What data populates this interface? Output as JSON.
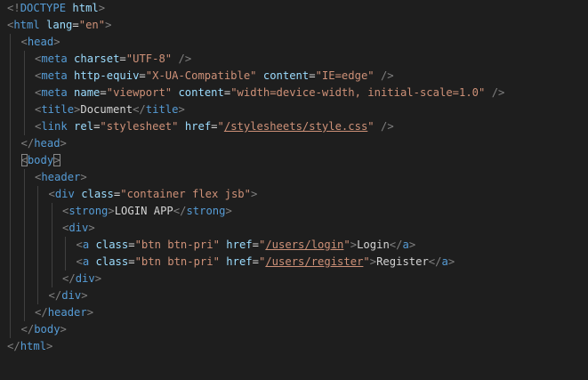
{
  "editor": {
    "language": "html",
    "theme_colors": {
      "background": "#1e1e1e",
      "punctuation": "#808080",
      "tag": "#569cd6",
      "attribute": "#9cdcfe",
      "string": "#ce9178",
      "text": "#d4d4d4",
      "indent_guide": "#404040"
    },
    "lines": [
      {
        "indent": 0,
        "tokens": [
          {
            "t": "punct",
            "v": "<!"
          },
          {
            "t": "tag",
            "v": "DOCTYPE"
          },
          {
            "t": "text",
            "v": " "
          },
          {
            "t": "attr",
            "v": "html"
          },
          {
            "t": "punct",
            "v": ">"
          }
        ]
      },
      {
        "indent": 0,
        "tokens": [
          {
            "t": "punct",
            "v": "<"
          },
          {
            "t": "tag",
            "v": "html"
          },
          {
            "t": "text",
            "v": " "
          },
          {
            "t": "attr",
            "v": "lang"
          },
          {
            "t": "text",
            "v": "="
          },
          {
            "t": "str",
            "v": "\"en\""
          },
          {
            "t": "punct",
            "v": ">"
          }
        ]
      },
      {
        "indent": 1,
        "tokens": [
          {
            "t": "punct",
            "v": "<"
          },
          {
            "t": "tag",
            "v": "head"
          },
          {
            "t": "punct",
            "v": ">"
          }
        ]
      },
      {
        "indent": 2,
        "tokens": [
          {
            "t": "punct",
            "v": "<"
          },
          {
            "t": "tag",
            "v": "meta"
          },
          {
            "t": "text",
            "v": " "
          },
          {
            "t": "attr",
            "v": "charset"
          },
          {
            "t": "text",
            "v": "="
          },
          {
            "t": "str",
            "v": "\"UTF-8\""
          },
          {
            "t": "text",
            "v": " "
          },
          {
            "t": "punct",
            "v": "/>"
          }
        ]
      },
      {
        "indent": 2,
        "tokens": [
          {
            "t": "punct",
            "v": "<"
          },
          {
            "t": "tag",
            "v": "meta"
          },
          {
            "t": "text",
            "v": " "
          },
          {
            "t": "attr",
            "v": "http-equiv"
          },
          {
            "t": "text",
            "v": "="
          },
          {
            "t": "str",
            "v": "\"X-UA-Compatible\""
          },
          {
            "t": "text",
            "v": " "
          },
          {
            "t": "attr",
            "v": "content"
          },
          {
            "t": "text",
            "v": "="
          },
          {
            "t": "str",
            "v": "\"IE=edge\""
          },
          {
            "t": "text",
            "v": " "
          },
          {
            "t": "punct",
            "v": "/>"
          }
        ]
      },
      {
        "indent": 2,
        "tokens": [
          {
            "t": "punct",
            "v": "<"
          },
          {
            "t": "tag",
            "v": "meta"
          },
          {
            "t": "text",
            "v": " "
          },
          {
            "t": "attr",
            "v": "name"
          },
          {
            "t": "text",
            "v": "="
          },
          {
            "t": "str",
            "v": "\"viewport\""
          },
          {
            "t": "text",
            "v": " "
          },
          {
            "t": "attr",
            "v": "content"
          },
          {
            "t": "text",
            "v": "="
          },
          {
            "t": "str",
            "v": "\"width=device-width, initial-scale=1.0\""
          },
          {
            "t": "text",
            "v": " "
          },
          {
            "t": "punct",
            "v": "/>"
          }
        ]
      },
      {
        "indent": 2,
        "tokens": [
          {
            "t": "punct",
            "v": "<"
          },
          {
            "t": "tag",
            "v": "title"
          },
          {
            "t": "punct",
            "v": ">"
          },
          {
            "t": "text",
            "v": "Document"
          },
          {
            "t": "punct",
            "v": "</"
          },
          {
            "t": "tag",
            "v": "title"
          },
          {
            "t": "punct",
            "v": ">"
          }
        ]
      },
      {
        "indent": 2,
        "tokens": [
          {
            "t": "punct",
            "v": "<"
          },
          {
            "t": "tag",
            "v": "link"
          },
          {
            "t": "text",
            "v": " "
          },
          {
            "t": "attr",
            "v": "rel"
          },
          {
            "t": "text",
            "v": "="
          },
          {
            "t": "str",
            "v": "\"stylesheet\""
          },
          {
            "t": "text",
            "v": " "
          },
          {
            "t": "attr",
            "v": "href"
          },
          {
            "t": "text",
            "v": "="
          },
          {
            "t": "str",
            "v": "\""
          },
          {
            "t": "link",
            "v": "/stylesheets/style.css"
          },
          {
            "t": "str",
            "v": "\""
          },
          {
            "t": "text",
            "v": " "
          },
          {
            "t": "punct",
            "v": "/>"
          }
        ]
      },
      {
        "indent": 1,
        "tokens": [
          {
            "t": "punct",
            "v": "</"
          },
          {
            "t": "tag",
            "v": "head"
          },
          {
            "t": "punct",
            "v": ">"
          }
        ]
      },
      {
        "indent": 1,
        "tokens": [
          {
            "t": "punct",
            "v": "<",
            "match": true
          },
          {
            "t": "tag",
            "v": "body"
          },
          {
            "t": "punct",
            "v": ">",
            "match": true
          }
        ]
      },
      {
        "indent": 2,
        "tokens": [
          {
            "t": "punct",
            "v": "<"
          },
          {
            "t": "tag",
            "v": "header"
          },
          {
            "t": "punct",
            "v": ">"
          }
        ]
      },
      {
        "indent": 3,
        "tokens": [
          {
            "t": "punct",
            "v": "<"
          },
          {
            "t": "tag",
            "v": "div"
          },
          {
            "t": "text",
            "v": " "
          },
          {
            "t": "attr",
            "v": "class"
          },
          {
            "t": "text",
            "v": "="
          },
          {
            "t": "str",
            "v": "\"container flex jsb\""
          },
          {
            "t": "punct",
            "v": ">"
          }
        ]
      },
      {
        "indent": 4,
        "tokens": [
          {
            "t": "punct",
            "v": "<"
          },
          {
            "t": "tag",
            "v": "strong"
          },
          {
            "t": "punct",
            "v": ">"
          },
          {
            "t": "text",
            "v": "LOGIN APP"
          },
          {
            "t": "punct",
            "v": "</"
          },
          {
            "t": "tag",
            "v": "strong"
          },
          {
            "t": "punct",
            "v": ">"
          }
        ]
      },
      {
        "indent": 4,
        "tokens": [
          {
            "t": "punct",
            "v": "<"
          },
          {
            "t": "tag",
            "v": "div"
          },
          {
            "t": "punct",
            "v": ">"
          }
        ]
      },
      {
        "indent": 5,
        "tokens": [
          {
            "t": "punct",
            "v": "<"
          },
          {
            "t": "tag",
            "v": "a"
          },
          {
            "t": "text",
            "v": " "
          },
          {
            "t": "attr",
            "v": "class"
          },
          {
            "t": "text",
            "v": "="
          },
          {
            "t": "str",
            "v": "\"btn btn-pri\""
          },
          {
            "t": "text",
            "v": " "
          },
          {
            "t": "attr",
            "v": "href"
          },
          {
            "t": "text",
            "v": "="
          },
          {
            "t": "str",
            "v": "\""
          },
          {
            "t": "link",
            "v": "/users/login"
          },
          {
            "t": "str",
            "v": "\""
          },
          {
            "t": "punct",
            "v": ">"
          },
          {
            "t": "text",
            "v": "Login"
          },
          {
            "t": "punct",
            "v": "</"
          },
          {
            "t": "tag",
            "v": "a"
          },
          {
            "t": "punct",
            "v": ">"
          }
        ]
      },
      {
        "indent": 5,
        "tokens": [
          {
            "t": "punct",
            "v": "<"
          },
          {
            "t": "tag",
            "v": "a"
          },
          {
            "t": "text",
            "v": " "
          },
          {
            "t": "attr",
            "v": "class"
          },
          {
            "t": "text",
            "v": "="
          },
          {
            "t": "str",
            "v": "\"btn btn-pri\""
          },
          {
            "t": "text",
            "v": " "
          },
          {
            "t": "attr",
            "v": "href"
          },
          {
            "t": "text",
            "v": "="
          },
          {
            "t": "str",
            "v": "\""
          },
          {
            "t": "link",
            "v": "/users/register"
          },
          {
            "t": "str",
            "v": "\""
          },
          {
            "t": "punct",
            "v": ">"
          },
          {
            "t": "text",
            "v": "Register"
          },
          {
            "t": "punct",
            "v": "</"
          },
          {
            "t": "tag",
            "v": "a"
          },
          {
            "t": "punct",
            "v": ">"
          }
        ]
      },
      {
        "indent": 4,
        "tokens": [
          {
            "t": "punct",
            "v": "</"
          },
          {
            "t": "tag",
            "v": "div"
          },
          {
            "t": "punct",
            "v": ">"
          }
        ]
      },
      {
        "indent": 3,
        "tokens": [
          {
            "t": "punct",
            "v": "</"
          },
          {
            "t": "tag",
            "v": "div"
          },
          {
            "t": "punct",
            "v": ">"
          }
        ]
      },
      {
        "indent": 2,
        "tokens": [
          {
            "t": "punct",
            "v": "</"
          },
          {
            "t": "tag",
            "v": "header"
          },
          {
            "t": "punct",
            "v": ">"
          }
        ]
      },
      {
        "indent": 1,
        "tokens": [
          {
            "t": "punct",
            "v": "</"
          },
          {
            "t": "tag",
            "v": "body"
          },
          {
            "t": "punct",
            "v": ">"
          }
        ]
      },
      {
        "indent": 0,
        "tokens": [
          {
            "t": "punct",
            "v": "</"
          },
          {
            "t": "tag",
            "v": "html"
          },
          {
            "t": "punct",
            "v": ">"
          }
        ]
      }
    ]
  }
}
